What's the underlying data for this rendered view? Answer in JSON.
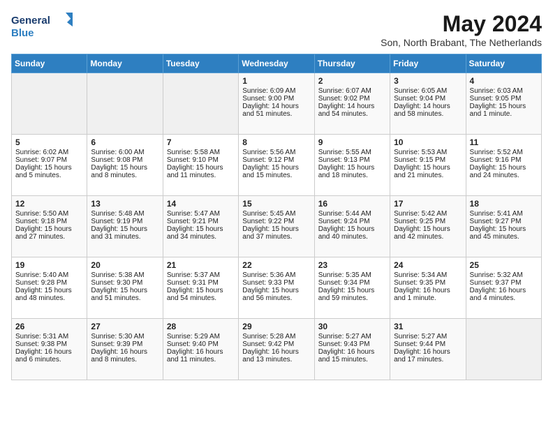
{
  "header": {
    "logo_line1": "General",
    "logo_line2": "Blue",
    "main_title": "May 2024",
    "subtitle": "Son, North Brabant, The Netherlands"
  },
  "days_of_week": [
    "Sunday",
    "Monday",
    "Tuesday",
    "Wednesday",
    "Thursday",
    "Friday",
    "Saturday"
  ],
  "weeks": [
    [
      {
        "day": "",
        "content": ""
      },
      {
        "day": "",
        "content": ""
      },
      {
        "day": "",
        "content": ""
      },
      {
        "day": "1",
        "content": "Sunrise: 6:09 AM\nSunset: 9:00 PM\nDaylight: 14 hours\nand 51 minutes."
      },
      {
        "day": "2",
        "content": "Sunrise: 6:07 AM\nSunset: 9:02 PM\nDaylight: 14 hours\nand 54 minutes."
      },
      {
        "day": "3",
        "content": "Sunrise: 6:05 AM\nSunset: 9:04 PM\nDaylight: 14 hours\nand 58 minutes."
      },
      {
        "day": "4",
        "content": "Sunrise: 6:03 AM\nSunset: 9:05 PM\nDaylight: 15 hours\nand 1 minute."
      }
    ],
    [
      {
        "day": "5",
        "content": "Sunrise: 6:02 AM\nSunset: 9:07 PM\nDaylight: 15 hours\nand 5 minutes."
      },
      {
        "day": "6",
        "content": "Sunrise: 6:00 AM\nSunset: 9:08 PM\nDaylight: 15 hours\nand 8 minutes."
      },
      {
        "day": "7",
        "content": "Sunrise: 5:58 AM\nSunset: 9:10 PM\nDaylight: 15 hours\nand 11 minutes."
      },
      {
        "day": "8",
        "content": "Sunrise: 5:56 AM\nSunset: 9:12 PM\nDaylight: 15 hours\nand 15 minutes."
      },
      {
        "day": "9",
        "content": "Sunrise: 5:55 AM\nSunset: 9:13 PM\nDaylight: 15 hours\nand 18 minutes."
      },
      {
        "day": "10",
        "content": "Sunrise: 5:53 AM\nSunset: 9:15 PM\nDaylight: 15 hours\nand 21 minutes."
      },
      {
        "day": "11",
        "content": "Sunrise: 5:52 AM\nSunset: 9:16 PM\nDaylight: 15 hours\nand 24 minutes."
      }
    ],
    [
      {
        "day": "12",
        "content": "Sunrise: 5:50 AM\nSunset: 9:18 PM\nDaylight: 15 hours\nand 27 minutes."
      },
      {
        "day": "13",
        "content": "Sunrise: 5:48 AM\nSunset: 9:19 PM\nDaylight: 15 hours\nand 31 minutes."
      },
      {
        "day": "14",
        "content": "Sunrise: 5:47 AM\nSunset: 9:21 PM\nDaylight: 15 hours\nand 34 minutes."
      },
      {
        "day": "15",
        "content": "Sunrise: 5:45 AM\nSunset: 9:22 PM\nDaylight: 15 hours\nand 37 minutes."
      },
      {
        "day": "16",
        "content": "Sunrise: 5:44 AM\nSunset: 9:24 PM\nDaylight: 15 hours\nand 40 minutes."
      },
      {
        "day": "17",
        "content": "Sunrise: 5:42 AM\nSunset: 9:25 PM\nDaylight: 15 hours\nand 42 minutes."
      },
      {
        "day": "18",
        "content": "Sunrise: 5:41 AM\nSunset: 9:27 PM\nDaylight: 15 hours\nand 45 minutes."
      }
    ],
    [
      {
        "day": "19",
        "content": "Sunrise: 5:40 AM\nSunset: 9:28 PM\nDaylight: 15 hours\nand 48 minutes."
      },
      {
        "day": "20",
        "content": "Sunrise: 5:38 AM\nSunset: 9:30 PM\nDaylight: 15 hours\nand 51 minutes."
      },
      {
        "day": "21",
        "content": "Sunrise: 5:37 AM\nSunset: 9:31 PM\nDaylight: 15 hours\nand 54 minutes."
      },
      {
        "day": "22",
        "content": "Sunrise: 5:36 AM\nSunset: 9:33 PM\nDaylight: 15 hours\nand 56 minutes."
      },
      {
        "day": "23",
        "content": "Sunrise: 5:35 AM\nSunset: 9:34 PM\nDaylight: 15 hours\nand 59 minutes."
      },
      {
        "day": "24",
        "content": "Sunrise: 5:34 AM\nSunset: 9:35 PM\nDaylight: 16 hours\nand 1 minute."
      },
      {
        "day": "25",
        "content": "Sunrise: 5:32 AM\nSunset: 9:37 PM\nDaylight: 16 hours\nand 4 minutes."
      }
    ],
    [
      {
        "day": "26",
        "content": "Sunrise: 5:31 AM\nSunset: 9:38 PM\nDaylight: 16 hours\nand 6 minutes."
      },
      {
        "day": "27",
        "content": "Sunrise: 5:30 AM\nSunset: 9:39 PM\nDaylight: 16 hours\nand 8 minutes."
      },
      {
        "day": "28",
        "content": "Sunrise: 5:29 AM\nSunset: 9:40 PM\nDaylight: 16 hours\nand 11 minutes."
      },
      {
        "day": "29",
        "content": "Sunrise: 5:28 AM\nSunset: 9:42 PM\nDaylight: 16 hours\nand 13 minutes."
      },
      {
        "day": "30",
        "content": "Sunrise: 5:27 AM\nSunset: 9:43 PM\nDaylight: 16 hours\nand 15 minutes."
      },
      {
        "day": "31",
        "content": "Sunrise: 5:27 AM\nSunset: 9:44 PM\nDaylight: 16 hours\nand 17 minutes."
      },
      {
        "day": "",
        "content": ""
      }
    ]
  ]
}
